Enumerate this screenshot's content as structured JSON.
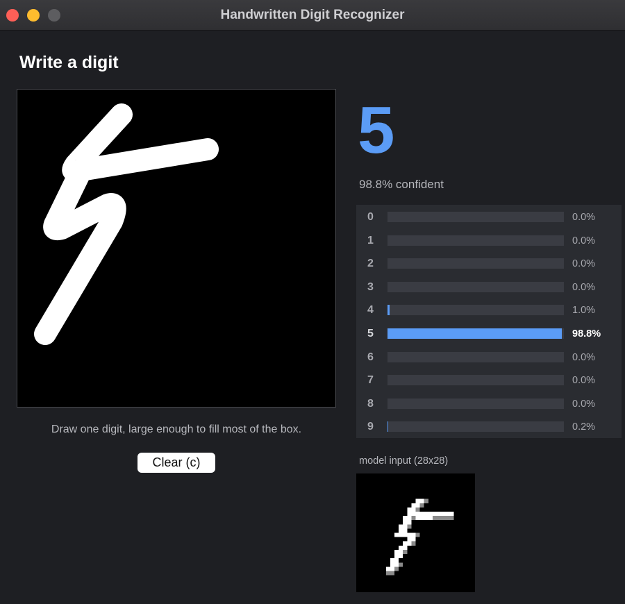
{
  "window": {
    "title": "Handwritten Digit Recognizer"
  },
  "canvas": {
    "heading": "Write a digit",
    "hint": "Draw one digit, large enough to fill most of the box.",
    "clear_label": "Clear  (c)"
  },
  "result": {
    "digit": "5",
    "confidence_text": "98.8% confident"
  },
  "probabilities": [
    {
      "digit": "0",
      "value": 0.0,
      "label": "0.0%"
    },
    {
      "digit": "1",
      "value": 0.0,
      "label": "0.0%"
    },
    {
      "digit": "2",
      "value": 0.0,
      "label": "0.0%"
    },
    {
      "digit": "3",
      "value": 0.0,
      "label": "0.0%"
    },
    {
      "digit": "4",
      "value": 0.01,
      "label": "1.0%"
    },
    {
      "digit": "5",
      "value": 0.988,
      "label": "98.8%"
    },
    {
      "digit": "6",
      "value": 0.0,
      "label": "0.0%"
    },
    {
      "digit": "7",
      "value": 0.0,
      "label": "0.0%"
    },
    {
      "digit": "8",
      "value": 0.0,
      "label": "0.0%"
    },
    {
      "digit": "9",
      "value": 0.002,
      "label": "0.2%"
    }
  ],
  "model_input": {
    "label": "model input (28x28)"
  },
  "colors": {
    "accent": "#5b9cf6",
    "background": "#1e1f23",
    "panel": "#2a2c31",
    "track": "#3a3c43"
  }
}
